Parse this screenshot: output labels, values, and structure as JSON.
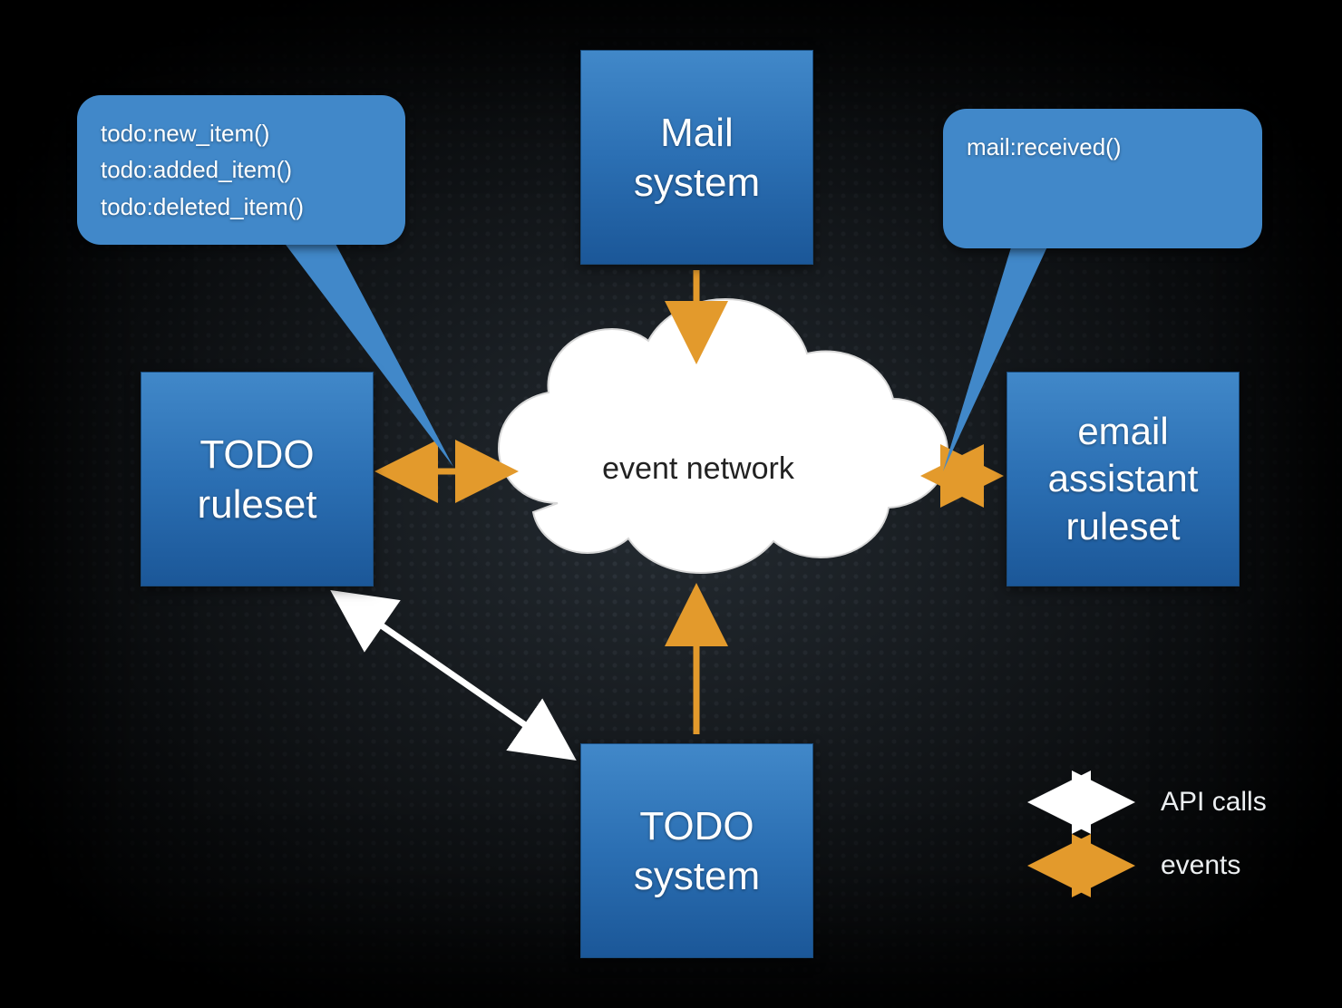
{
  "nodes": {
    "mail_system": "Mail\nsystem",
    "todo_ruleset": "TODO\nruleset",
    "email_assistant": "email\nassistant\nruleset",
    "todo_system": "TODO\nsystem",
    "event_network": "event network"
  },
  "callouts": {
    "todo_events": [
      "todo:new_item()",
      "todo:added_item()",
      "todo:deleted_item()"
    ],
    "mail_events": [
      "mail:received()"
    ]
  },
  "legend": {
    "api_calls": "API calls",
    "events": "events"
  },
  "colors": {
    "box": "#2f73b5",
    "callout": "#4188c9",
    "arrow_events": "#e39a2c",
    "arrow_api": "#ffffff"
  }
}
